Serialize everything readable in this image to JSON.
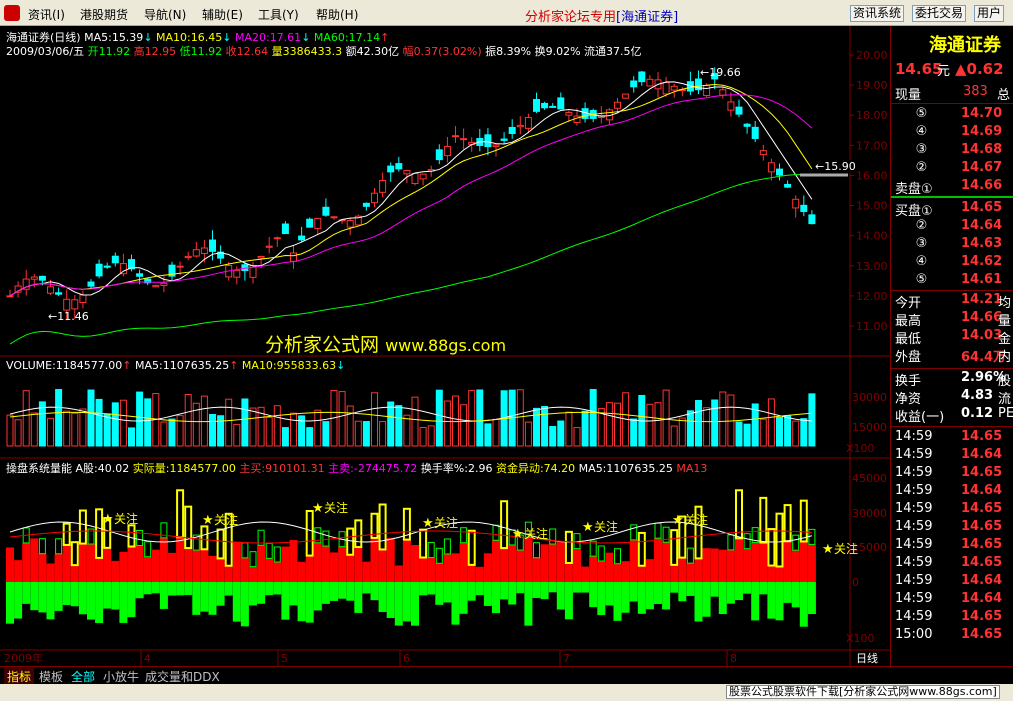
{
  "menu": {
    "items": [
      "资讯(I)",
      "港股期货",
      "导航(N)",
      "辅助(E)",
      "工具(Y)",
      "帮助(H)"
    ],
    "title_main": "分析家论坛专用",
    "title_sub": "[海通证券]",
    "buttons": [
      "资讯系统",
      "委托交易",
      "用户"
    ]
  },
  "chart": {
    "header_name": "海通证券(日线)",
    "ma5": "MA5:15.39",
    "ma10": "MA10:16.45",
    "ma20": "MA20:17.61",
    "ma60": "MA60:17.14",
    "date_label": "2009/03/06/五",
    "open": "开11.92",
    "high": "高12.95",
    "low": "低11.92",
    "close": "收12.64",
    "volume": "量3386433.3",
    "amount": "额42.30亿",
    "range": "幅0.37(3.02%)",
    "swing": "振8.39%",
    "turnover": "换9.02%",
    "float": "流通37.5亿",
    "high_mark": "19.66",
    "low_mark": "11.46",
    "level_mark": "15.90",
    "watermark": "分析家公式网",
    "watermark_url": "www.88gs.com",
    "price_ticks": [
      "20.00",
      "19.00",
      "18.00",
      "17.00",
      "16.00",
      "15.00",
      "14.00",
      "13.00",
      "12.00",
      "11.00"
    ]
  },
  "volume_panel": {
    "label": "VOLUME:1184577.00",
    "ma5": "MA5:1107635.25",
    "ma10": "MA10:955833.63",
    "ticks": [
      "30000",
      "15000"
    ],
    "unit": "X100"
  },
  "indicator_panel": {
    "name": "操盘系统量能",
    "a_stock": "A股:40.02",
    "actual": "实际量:1184577.00",
    "main_buy": "主买:910101.31",
    "main_sell": "主卖:-274475.72",
    "turnover_rate": "换手率%:2.96",
    "fund_flow": "资金异动:74.20",
    "ma5": "MA5:1107635.25",
    "ma13": "MA13",
    "ticks": [
      "45000",
      "30000",
      "15000",
      "0"
    ],
    "unit": "X100",
    "star_label": "关注"
  },
  "timeline": {
    "year": "2009年",
    "months": [
      "4",
      "5",
      "6",
      "7",
      "8"
    ],
    "period": "日线"
  },
  "quote": {
    "name": "海通证券",
    "price": "14.65",
    "unit": "元",
    "change": "▲0.62",
    "now_label": "现量",
    "now_value": "383",
    "total_label": "总",
    "sell_levels": [
      {
        "label": "⑤",
        "price": "14.70"
      },
      {
        "label": "④",
        "price": "14.69"
      },
      {
        "label": "③",
        "price": "14.68"
      },
      {
        "label": "②",
        "price": "14.67"
      },
      {
        "label": "卖盘①",
        "price": "14.66"
      }
    ],
    "buy_levels": [
      {
        "label": "买盘①",
        "price": "14.65"
      },
      {
        "label": "②",
        "price": "14.64"
      },
      {
        "label": "③",
        "price": "14.63"
      },
      {
        "label": "④",
        "price": "14.62"
      },
      {
        "label": "⑤",
        "price": "14.61"
      }
    ],
    "stats": [
      {
        "label": "今开",
        "value": "14.21",
        "tail": "均"
      },
      {
        "label": "最高",
        "value": "14.66",
        "tail": "量"
      },
      {
        "label": "最低",
        "value": "14.03",
        "tail": "金"
      },
      {
        "label": "外盘",
        "value": "64.4万",
        "tail": "内"
      }
    ],
    "fundamentals": [
      {
        "label": "换手",
        "value": "2.96%",
        "tail": "股"
      },
      {
        "label": "净资",
        "value": "4.83",
        "tail": "流"
      },
      {
        "label": "收益(一)",
        "value": "0.12",
        "tail": "PE"
      }
    ],
    "ticks": [
      {
        "time": "14:59",
        "price": "14.65"
      },
      {
        "time": "14:59",
        "price": "14.64"
      },
      {
        "time": "14:59",
        "price": "14.65"
      },
      {
        "time": "14:59",
        "price": "14.64"
      },
      {
        "time": "14:59",
        "price": "14.65"
      },
      {
        "time": "14:59",
        "price": "14.65"
      },
      {
        "time": "14:59",
        "price": "14.65"
      },
      {
        "time": "14:59",
        "price": "14.65"
      },
      {
        "time": "14:59",
        "price": "14.64"
      },
      {
        "time": "14:59",
        "price": "14.64"
      },
      {
        "time": "14:59",
        "price": "14.65"
      },
      {
        "time": "15:00",
        "price": "14.65"
      }
    ]
  },
  "tabs": [
    "指标",
    "模板",
    "全部",
    "小放牛",
    "成交量和DDX"
  ],
  "status": {
    "ad": "股票公式股票软件下载[分析家公式网www.88gs.com]"
  },
  "colors": {
    "up": "#ff3232",
    "down": "#00ffff",
    "ma5": "#ffffff",
    "ma10": "#ffff00",
    "ma20": "#ff00ff",
    "ma60": "#00ff00",
    "indicator_bar_up": "#ff0000",
    "indicator_bar_down": "#00ff00",
    "highlight_bar": "#ffff00"
  }
}
